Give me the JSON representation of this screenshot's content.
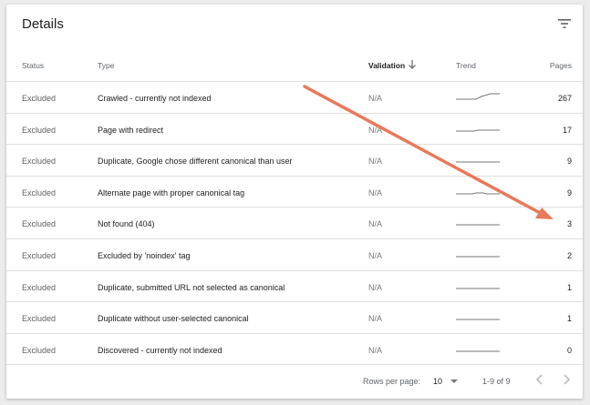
{
  "title": "Details",
  "columns": {
    "status": "Status",
    "type": "Type",
    "validation": "Validation",
    "trend": "Trend",
    "pages": "Pages"
  },
  "rows": [
    {
      "status": "Excluded",
      "type": "Crawled - currently not indexed",
      "validation": "N/A",
      "pages": "267"
    },
    {
      "status": "Excluded",
      "type": "Page with redirect",
      "validation": "N/A",
      "pages": "17"
    },
    {
      "status": "Excluded",
      "type": "Duplicate, Google chose different canonical than user",
      "validation": "N/A",
      "pages": "9"
    },
    {
      "status": "Excluded",
      "type": "Alternate page with proper canonical tag",
      "validation": "N/A",
      "pages": "9"
    },
    {
      "status": "Excluded",
      "type": "Not found (404)",
      "validation": "N/A",
      "pages": "3"
    },
    {
      "status": "Excluded",
      "type": "Excluded by 'noindex' tag",
      "validation": "N/A",
      "pages": "2"
    },
    {
      "status": "Excluded",
      "type": "Duplicate, submitted URL not selected as canonical",
      "validation": "N/A",
      "pages": "1"
    },
    {
      "status": "Excluded",
      "type": "Duplicate without user-selected canonical",
      "validation": "N/A",
      "pages": "1"
    },
    {
      "status": "Excluded",
      "type": "Discovered - currently not indexed",
      "validation": "N/A",
      "pages": "0"
    }
  ],
  "footer": {
    "rows_per_page_label": "Rows per page:",
    "rows_per_page_value": "10",
    "range": "1-9 of 9"
  },
  "icons": {
    "filter": "filter-icon",
    "sort": "arrow-down-icon",
    "dropdown": "dropdown-icon",
    "prev": "chevron-left-icon",
    "next": "chevron-right-icon"
  },
  "colors": {
    "annotation_arrow": "#e8795a",
    "sparkline": "#757575"
  }
}
